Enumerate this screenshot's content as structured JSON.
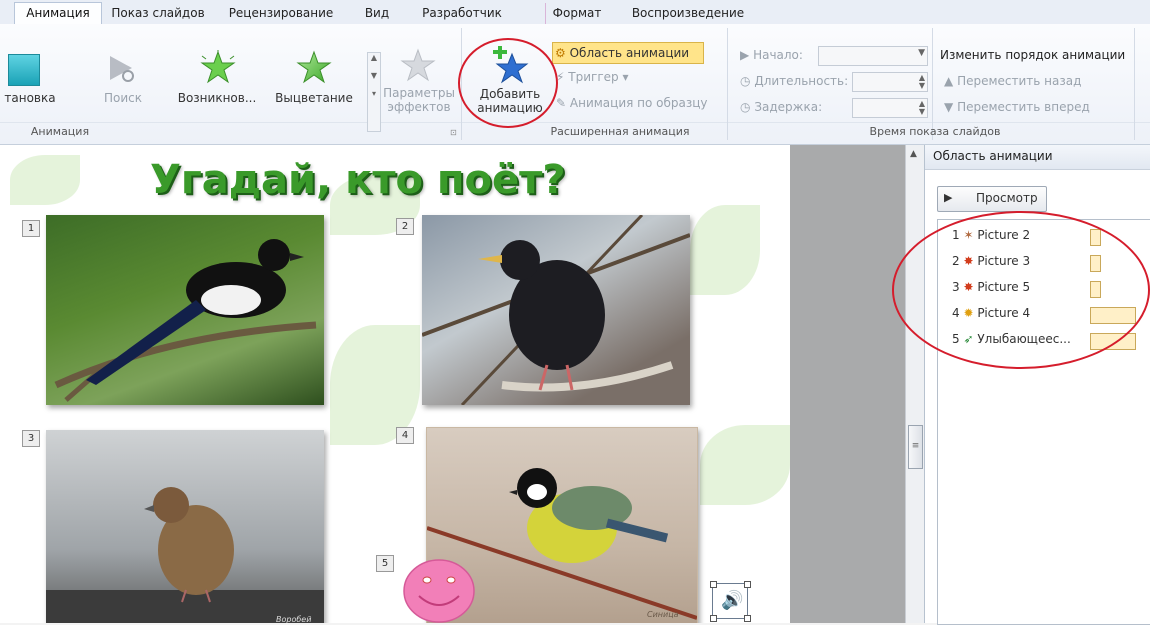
{
  "tabs": [
    "Анимация",
    "Показ слайдов",
    "Рецензирование",
    "Вид",
    "Разработчик",
    "Формат",
    "Воспроизведение"
  ],
  "ribbon": {
    "gallery": {
      "items": [
        "тановка",
        "Поиск",
        "Возникнов...",
        "Выцветание"
      ]
    },
    "effect_params_label": "Параметры эффектов",
    "add_animation_label": "Добавить анимацию",
    "anim_pane_btn": "Область анимации",
    "trigger_label": "Триггер",
    "painter_label": "Анимация по образцу",
    "start_label": "Начало:",
    "duration_label": "Длительность:",
    "delay_label": "Задержка:",
    "reorder_title": "Изменить порядок анимации",
    "move_back": "Переместить назад",
    "move_forward": "Переместить вперед",
    "group_animation": "Анимация",
    "group_advanced": "Расширенная анимация",
    "group_timing": "Время показа слайдов"
  },
  "slide": {
    "title": "Угадай, кто поёт?",
    "tags": [
      "1",
      "2",
      "3",
      "4",
      "5"
    ],
    "sparrow_caption": "Воробей",
    "tit_caption": "Синица"
  },
  "pane": {
    "title": "Область анимации",
    "preview_label": "Просмотр",
    "items": [
      {
        "num": "1",
        "name": "Picture 2"
      },
      {
        "num": "2",
        "name": "Picture 3"
      },
      {
        "num": "3",
        "name": "Picture 5"
      },
      {
        "num": "4",
        "name": "Picture 4"
      },
      {
        "num": "5",
        "name": "Улыбающеес..."
      }
    ]
  },
  "colors": {
    "accent_red": "#d51d2c",
    "title_green": "#3a9a2a",
    "highlight_btn": "#ffe48a"
  }
}
